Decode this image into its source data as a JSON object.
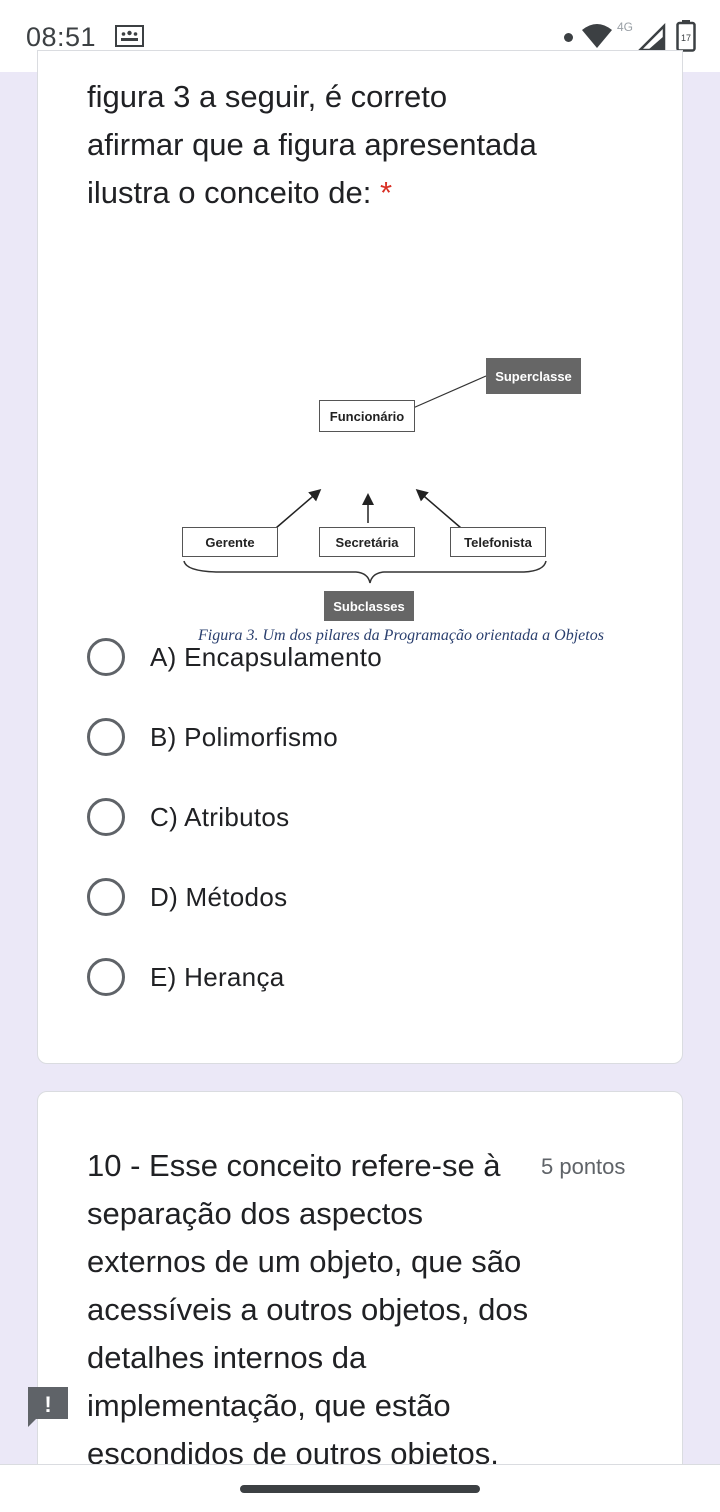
{
  "status_bar": {
    "time": "08:51",
    "network_type": "4G",
    "battery_level": "17",
    "icons": [
      "notification-icon",
      "dot-icon",
      "wifi-icon",
      "signal-icon",
      "battery-icon"
    ]
  },
  "question_9": {
    "text": "figura 3 a seguir, é correto afirmar que a figura apresentada ilustra o conceito de:",
    "required_marker": "*",
    "figure": {
      "superclass_tag": "Superclasse",
      "parent": "Funcionário",
      "children": [
        "Gerente",
        "Secretária",
        "Telefonista"
      ],
      "subclass_tag": "Subclasses",
      "caption": "Figura 3. Um dos pilares da Programação orientada a Objetos"
    },
    "options": [
      {
        "label": "A) Encapsulamento",
        "selected": false
      },
      {
        "label": "B) Polimorfismo",
        "selected": false
      },
      {
        "label": "C) Atributos",
        "selected": false
      },
      {
        "label": "D) Métodos",
        "selected": false
      },
      {
        "label": "E) Herança",
        "selected": false
      }
    ]
  },
  "question_10": {
    "text": "10 - Esse conceito refere-se à separação dos aspectos externos de um objeto, que são acessíveis a outros objetos, dos detalhes internos da implementação, que estão escondidos de outros objetos.",
    "points": "5 pontos"
  },
  "alert": {
    "glyph": "!"
  },
  "colors": {
    "page_background": "#ebe8f7",
    "required": "#d93025",
    "radio_border": "#5f6368",
    "alert": "#5f6368"
  }
}
